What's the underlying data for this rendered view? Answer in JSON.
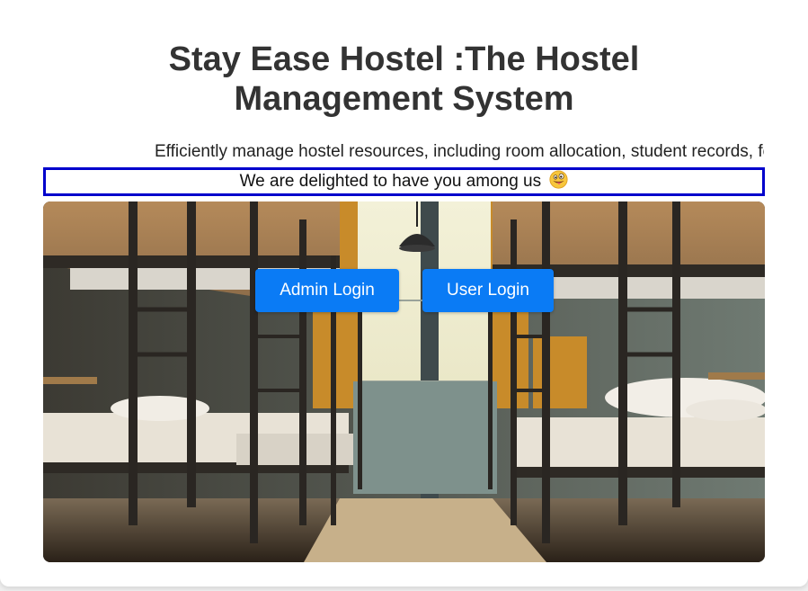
{
  "header": {
    "title": "Stay Ease Hostel :The Hostel Management System",
    "tagline": "Efficiently manage hostel resources, including room allocation, student records, fee management and more."
  },
  "banner": {
    "welcome_text": "We are delighted to have you among us",
    "emoji_icon": "grinning-tongue-emoji-icon"
  },
  "actions": {
    "admin_login_label": "Admin Login",
    "user_login_label": "User Login"
  },
  "colors": {
    "accent_button": "#0a7bf5",
    "banner_border": "#0000cc",
    "title_text": "#333333"
  }
}
